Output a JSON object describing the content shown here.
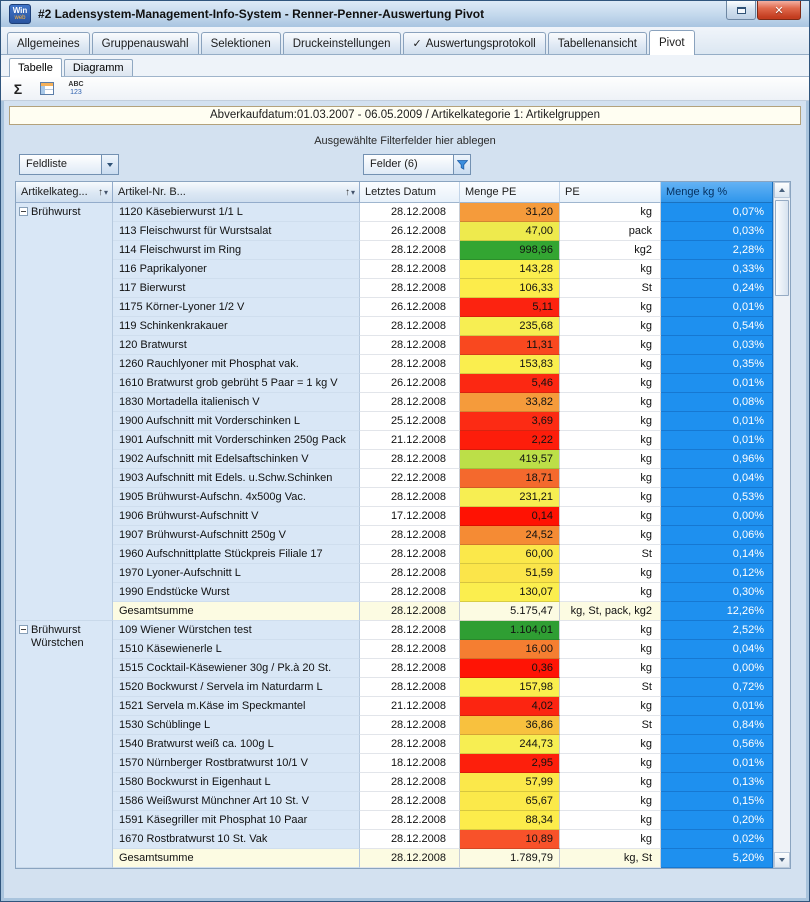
{
  "window": {
    "title": "#2 Ladensystem-Management-Info-System - Renner-Penner-Auswertung Pivot",
    "logo": {
      "top": "Win",
      "bottom": "web"
    }
  },
  "glyphs": {
    "check": "✓",
    "close": "✕",
    "sum": "Σ",
    "sort_asc": "↑",
    "dropdown_small": "▾"
  },
  "main_tabs": [
    {
      "label": "Allgemeines"
    },
    {
      "label": "Gruppenauswahl"
    },
    {
      "label": "Selektionen"
    },
    {
      "label": "Druckeinstellungen"
    },
    {
      "label": "Auswertungsprotokoll",
      "checked": true
    },
    {
      "label": "Tabellenansicht"
    },
    {
      "label": "Pivot",
      "active": true
    }
  ],
  "sub_tabs": [
    {
      "label": "Tabelle",
      "active": true
    },
    {
      "label": "Diagramm"
    }
  ],
  "toolbar": {
    "abc_top": "ABC",
    "abc_bottom": "123"
  },
  "info_bar": {
    "text": "Abverkaufdatum:01.03.2007 - 06.05.2009 / Artikelkategorie 1: Artikelgruppen"
  },
  "filter_area": {
    "hint": "Ausgewählte Filterfelder hier ablegen"
  },
  "field_buttons": {
    "field_list": "Feldliste",
    "fields": "Felder (6)"
  },
  "row_area_headers": [
    {
      "label": "Artikelkateg...",
      "sort": "↑"
    },
    {
      "label": "Artikel-Nr. B...",
      "sort": "↑"
    }
  ],
  "column_headers": [
    {
      "label": "Letztes Datum"
    },
    {
      "label": "Menge PE"
    },
    {
      "label": "PE"
    },
    {
      "label": "Menge kg %",
      "highlight": true
    }
  ],
  "colors": {
    "pct_fill": "#1e90ef",
    "total_bg": "#fcfbe2"
  },
  "groups": [
    {
      "name": "Brühwurst",
      "rows": [
        {
          "article": "1120 Käsebierwurst 1/1 L",
          "date": "28.12.2008",
          "value": "31,20",
          "value_color": "#f59b3b",
          "unit": "kg",
          "pct": "0,07%"
        },
        {
          "article": "113 Fleischwurst für Wurstsalat",
          "date": "26.12.2008",
          "value": "47,00",
          "value_color": "#eeea4d",
          "unit": "pack",
          "pct": "0,03%"
        },
        {
          "article": "114 Fleischwurst im Ring",
          "date": "28.12.2008",
          "value": "998,96",
          "value_color": "#33a532",
          "unit": "kg2",
          "pct": "2,28%"
        },
        {
          "article": "116 Paprikalyoner",
          "date": "28.12.2008",
          "value": "143,28",
          "value_color": "#fbee4e",
          "unit": "kg",
          "pct": "0,33%"
        },
        {
          "article": "117 Bierwurst",
          "date": "28.12.2008",
          "value": "106,33",
          "value_color": "#fcec4b",
          "unit": "St",
          "pct": "0,24%"
        },
        {
          "article": "1175 Körner-Lyoner 1/2 V",
          "date": "26.12.2008",
          "value": "5,11",
          "value_color": "#fc2310",
          "unit": "kg",
          "pct": "0,01%"
        },
        {
          "article": "119 Schinkenkrakauer",
          "date": "28.12.2008",
          "value": "235,68",
          "value_color": "#f7ee52",
          "unit": "kg",
          "pct": "0,54%"
        },
        {
          "article": "120 Bratwurst",
          "date": "28.12.2008",
          "value": "11,31",
          "value_color": "#f9481f",
          "unit": "kg",
          "pct": "0,03%"
        },
        {
          "article": "1260 Rauchlyoner mit Phosphat vak.",
          "date": "28.12.2008",
          "value": "153,83",
          "value_color": "#faee4e",
          "unit": "kg",
          "pct": "0,35%"
        },
        {
          "article": "1610 Bratwurst grob gebrüht 5 Paar = 1 kg V",
          "date": "26.12.2008",
          "value": "5,46",
          "value_color": "#fc2812",
          "unit": "kg",
          "pct": "0,01%"
        },
        {
          "article": "1830 Mortadella italienisch V",
          "date": "28.12.2008",
          "value": "33,82",
          "value_color": "#f59b3b",
          "unit": "kg",
          "pct": "0,08%"
        },
        {
          "article": "1900 Aufschnitt mit Vorderschinken L",
          "date": "25.12.2008",
          "value": "3,69",
          "value_color": "#fc2b14",
          "unit": "kg",
          "pct": "0,01%"
        },
        {
          "article": "1901 Aufschnitt mit Vorderschinken 250g Pack",
          "date": "21.12.2008",
          "value": "2,22",
          "value_color": "#fd1d0b",
          "unit": "kg",
          "pct": "0,01%"
        },
        {
          "article": "1902 Aufschnitt mit Edelsaftschinken V",
          "date": "28.12.2008",
          "value": "419,57",
          "value_color": "#bcdf48",
          "unit": "kg",
          "pct": "0,96%"
        },
        {
          "article": "1903 Aufschnitt mit Edels. u.Schw.Schinken",
          "date": "22.12.2008",
          "value": "18,71",
          "value_color": "#f4692d",
          "unit": "kg",
          "pct": "0,04%"
        },
        {
          "article": "1905 Brühwurst-Aufschn. 4x500g Vac.",
          "date": "28.12.2008",
          "value": "231,21",
          "value_color": "#f7ee52",
          "unit": "kg",
          "pct": "0,53%"
        },
        {
          "article": "1906 Brühwurst-Aufschnitt V",
          "date": "17.12.2008",
          "value": "0,14",
          "value_color": "#ff1203",
          "unit": "kg",
          "pct": "0,00%"
        },
        {
          "article": "1907 Brühwurst-Aufschnitt 250g V",
          "date": "28.12.2008",
          "value": "24,52",
          "value_color": "#f58b34",
          "unit": "kg",
          "pct": "0,06%"
        },
        {
          "article": "1960 Aufschnittplatte Stückpreis Filiale 17",
          "date": "28.12.2008",
          "value": "60,00",
          "value_color": "#fbe84a",
          "unit": "St",
          "pct": "0,14%"
        },
        {
          "article": "1970 Lyoner-Aufschnitt L",
          "date": "28.12.2008",
          "value": "51,59",
          "value_color": "#fbe54a",
          "unit": "kg",
          "pct": "0,12%"
        },
        {
          "article": "1990 Endstücke Wurst",
          "date": "28.12.2008",
          "value": "130,07",
          "value_color": "#fbee4e",
          "unit": "kg",
          "pct": "0,30%"
        }
      ],
      "total": {
        "label": "Gesamtsumme",
        "date": "28.12.2008",
        "value": "5.175,47",
        "unit": "kg, St, pack, kg2",
        "pct": "12,26%"
      }
    },
    {
      "name": "Brühwurst Würstchen",
      "rows": [
        {
          "article": "109 Wiener Würstchen test",
          "date": "28.12.2008",
          "value": "1.104,01",
          "value_color": "#2f9e33",
          "unit": "kg",
          "pct": "2,52%"
        },
        {
          "article": "1510 Käsewienerle L",
          "date": "28.12.2008",
          "value": "16,00",
          "value_color": "#f57e31",
          "unit": "kg",
          "pct": "0,04%"
        },
        {
          "article": "1515 Cocktail-Käsewiener 30g / Pk.à 20 St.",
          "date": "28.12.2008",
          "value": "0,36",
          "value_color": "#ff1405",
          "unit": "kg",
          "pct": "0,00%"
        },
        {
          "article": "1520 Bockwurst / Servela im Naturdarm L",
          "date": "28.12.2008",
          "value": "157,98",
          "value_color": "#faee4e",
          "unit": "St",
          "pct": "0,72%"
        },
        {
          "article": "1521 Servela m.Käse im Speckmantel",
          "date": "21.12.2008",
          "value": "4,02",
          "value_color": "#fc2511",
          "unit": "kg",
          "pct": "0,01%"
        },
        {
          "article": "1530 Schüblinge L",
          "date": "28.12.2008",
          "value": "36,86",
          "value_color": "#f8c13e",
          "unit": "St",
          "pct": "0,84%"
        },
        {
          "article": "1540 Bratwurst weiß ca. 100g L",
          "date": "28.12.2008",
          "value": "244,73",
          "value_color": "#f7ee52",
          "unit": "kg",
          "pct": "0,56%"
        },
        {
          "article": "1570 Nürnberger Rostbratwurst 10/1 V",
          "date": "18.12.2008",
          "value": "2,95",
          "value_color": "#fd1f0c",
          "unit": "kg",
          "pct": "0,01%"
        },
        {
          "article": "1580 Bockwurst in Eigenhaut L",
          "date": "28.12.2008",
          "value": "57,99",
          "value_color": "#fbe84a",
          "unit": "kg",
          "pct": "0,13%"
        },
        {
          "article": "1586 Weißwurst Münchner Art 10 St. V",
          "date": "28.12.2008",
          "value": "65,67",
          "value_color": "#fbe94a",
          "unit": "kg",
          "pct": "0,15%"
        },
        {
          "article": "1591 Käsegriller mit Phosphat 10 Paar",
          "date": "28.12.2008",
          "value": "88,34",
          "value_color": "#fcec4b",
          "unit": "kg",
          "pct": "0,20%"
        },
        {
          "article": "1670 Rostbratwurst 10 St. Vak",
          "date": "28.12.2008",
          "value": "10,89",
          "value_color": "#f8522a",
          "unit": "kg",
          "pct": "0,02%"
        }
      ],
      "total": {
        "label": "Gesamtsumme",
        "date": "28.12.2008",
        "value": "1.789,79",
        "unit": "kg, St",
        "pct": "5,20%"
      }
    }
  ]
}
